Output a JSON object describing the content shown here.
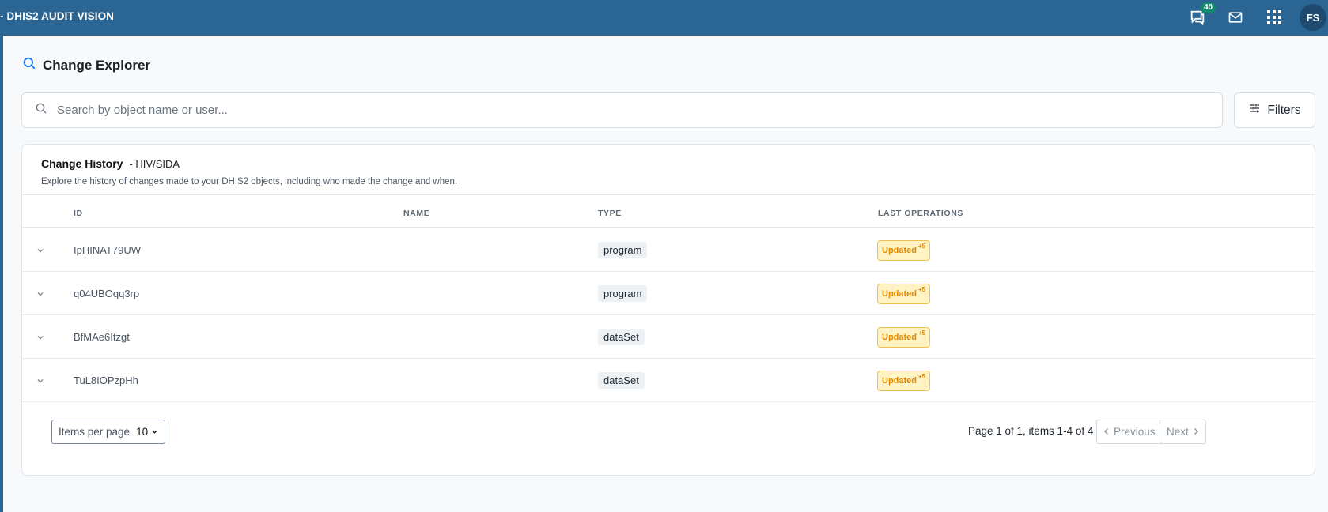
{
  "app": {
    "title": "- DHIS2 AUDIT VISION"
  },
  "header": {
    "notification_count": "40",
    "user_initials": "FS",
    "icons": [
      "chat-icon",
      "mail-icon",
      "apps-grid-icon"
    ]
  },
  "page": {
    "title": "Change Explorer"
  },
  "search": {
    "placeholder": "Search by object name or user..."
  },
  "filters": {
    "label": "Filters"
  },
  "card": {
    "title": "Change History",
    "subtitle": "- HIV/SIDA",
    "description": "Explore the history of changes made to your DHIS2 objects, including who made the change and when."
  },
  "table": {
    "columns": [
      "ID",
      "NAME",
      "TYPE",
      "LAST OPERATIONS"
    ],
    "rows": [
      {
        "id": "IpHINAT79UW",
        "name": "",
        "type": "program",
        "op": "Updated",
        "op_extra": "+5"
      },
      {
        "id": "q04UBOqq3rp",
        "name": "",
        "type": "program",
        "op": "Updated",
        "op_extra": "+5"
      },
      {
        "id": "BfMAe6Itzgt",
        "name": "",
        "type": "dataSet",
        "op": "Updated",
        "op_extra": "+5"
      },
      {
        "id": "TuL8IOPzpHh",
        "name": "",
        "type": "dataSet",
        "op": "Updated",
        "op_extra": "+5"
      }
    ]
  },
  "pagination": {
    "items_per_page_label": "Items per page",
    "items_per_page_value": "10",
    "page_info": "Page 1 of 1, items 1-4 of 4",
    "previous_label": "Previous",
    "next_label": "Next"
  },
  "colors": {
    "topbar": "#2b6593",
    "accent": "#1a73e8",
    "badge_bg": "#118a6b",
    "updated_bg": "#fff3c4",
    "updated_text": "#e08a00"
  }
}
